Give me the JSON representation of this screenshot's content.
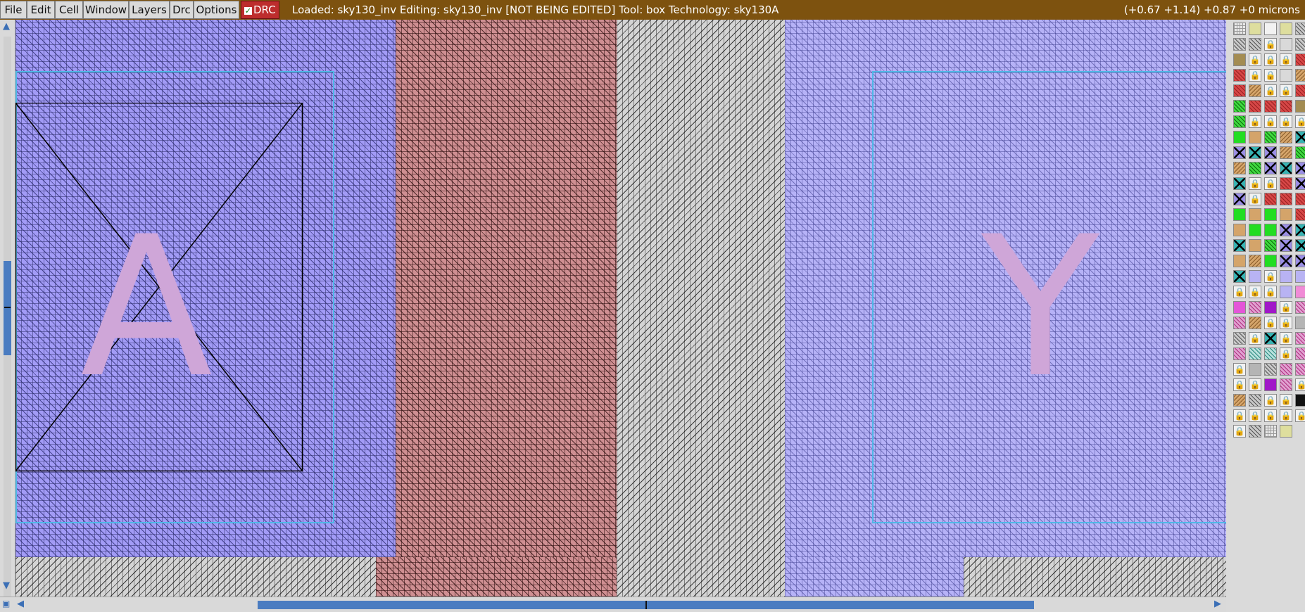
{
  "menu": {
    "items": [
      "File",
      "Edit",
      "Cell",
      "Window",
      "Layers",
      "Drc",
      "Options"
    ]
  },
  "drc_toggle": {
    "label": "DRC",
    "checked": true
  },
  "status": {
    "text": "Loaded: sky130_inv Editing: sky130_inv [NOT BEING EDITED] Tool: box  Technology: sky130A",
    "coords": "(+0.67 +1.14) +0.87 +0 microns"
  },
  "canvas": {
    "labels": [
      "A",
      "Y"
    ]
  },
  "colors": {
    "titlebar": "#7d520f",
    "drc_active": "#bd2d2d",
    "scroll_thumb": "#4a7cc1",
    "metal": "#a29bf6",
    "poly": "#cf8f92",
    "label_text": "#cfa6d8"
  },
  "palette": {
    "swatches": [
      [
        "gridd",
        "yellow",
        "white",
        "yellow",
        "grayh"
      ],
      [
        "grayh",
        "grayh",
        "lock",
        "blank",
        "grayh"
      ],
      [
        "olive",
        "lock",
        "lock",
        "lock",
        "red"
      ],
      [
        "red",
        "lock",
        "lock",
        "blank",
        "tanh"
      ],
      [
        "red",
        "tanh",
        "lock",
        "lock",
        "red"
      ],
      [
        "greenh",
        "red",
        "red",
        "red",
        "olive"
      ],
      [
        "greenh",
        "lock",
        "lock",
        "lock",
        "lock"
      ],
      [
        "green",
        "tan",
        "greenh",
        "tanh",
        "cyan"
      ],
      [
        "purple",
        "cyan",
        "purple",
        "tanh",
        "greenh"
      ],
      [
        "tanh",
        "greenh",
        "purple",
        "cyan",
        "purple"
      ],
      [
        "cyan",
        "lock",
        "lock",
        "red",
        "purple"
      ],
      [
        "purple",
        "lock",
        "red",
        "red",
        "red"
      ],
      [
        "green",
        "tan",
        "green",
        "tan",
        "red"
      ],
      [
        "tan",
        "green",
        "green",
        "purple",
        "cyan"
      ],
      [
        "cyan",
        "tan",
        "greenh",
        "purple",
        "cyan"
      ],
      [
        "tan",
        "tanh",
        "green",
        "purple",
        "purple"
      ],
      [
        "cyan",
        "lilac",
        "lock",
        "lilac",
        "lilac"
      ],
      [
        "lock",
        "lock",
        "lock",
        "lilac",
        "pink"
      ],
      [
        "magenta",
        "pinkh",
        "violet",
        "lock",
        "pinkh"
      ],
      [
        "pinkh",
        "tanh",
        "lock",
        "lock",
        "gray"
      ],
      [
        "grayh",
        "lock",
        "cyan",
        "lock",
        "pinkh"
      ],
      [
        "pinkh",
        "teal",
        "teal",
        "lock",
        "pinkh"
      ],
      [
        "lock",
        "gray",
        "grayh",
        "pinkh",
        "pinkh"
      ],
      [
        "lock",
        "lock",
        "violet",
        "pinkh",
        "lock"
      ],
      [
        "tanh",
        "grayh",
        "lock",
        "lock",
        "black"
      ],
      [
        "lock",
        "lock",
        "lock",
        "lock",
        "lock"
      ],
      [
        "lock",
        "grayh",
        "gridd",
        "yellow",
        "none"
      ]
    ]
  }
}
